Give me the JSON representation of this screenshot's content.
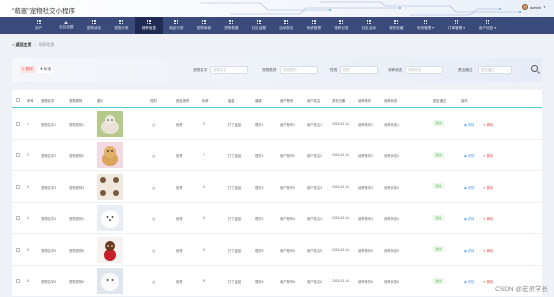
{
  "header": {
    "app_title": "\"萌崽\"宠物社交小程序",
    "username": "admin"
  },
  "nav": {
    "items": [
      {
        "label": "用户",
        "icon": "grid-icon"
      },
      {
        "label": "社区话题",
        "icon": "house-icon"
      },
      {
        "label": "宠物动态",
        "icon": "grid-icon"
      },
      {
        "label": "宠物分类",
        "icon": "grid-icon"
      },
      {
        "label": "领养信息",
        "icon": "grid-icon",
        "active": true
      },
      {
        "label": "商品分类",
        "icon": "grid-icon"
      },
      {
        "label": "宠物商城",
        "icon": "grid-icon"
      },
      {
        "label": "宠物救援",
        "icon": "grid-icon"
      },
      {
        "label": "社区话题",
        "icon": "grid-icon"
      },
      {
        "label": "活动报名",
        "icon": "grid-icon"
      },
      {
        "label": "系统管理",
        "icon": "grid-icon"
      },
      {
        "label": "领养记录",
        "icon": "grid-icon"
      },
      {
        "label": "社区活动",
        "icon": "grid-icon"
      },
      {
        "label": "我的收藏",
        "icon": "grid-icon"
      },
      {
        "label": "系统管理 ▾",
        "icon": "grid-icon"
      },
      {
        "label": "订单管理 ▾",
        "icon": "grid-icon"
      },
      {
        "label": "用户信息 ▾",
        "icon": "grid-icon"
      }
    ]
  },
  "breadcrumb": {
    "home": "返回主页",
    "sep": "/",
    "current": "领养信息"
  },
  "toolbar": {
    "delete_label": "✕ 删除",
    "add_label": "✚ 新增"
  },
  "search": {
    "fields": [
      {
        "label": "宠物名字",
        "placeholder": "宠物名字"
      },
      {
        "label": "宠物类别",
        "placeholder": "宠物类别"
      },
      {
        "label": "性别",
        "placeholder": "性别"
      },
      {
        "label": "领养状态",
        "placeholder": "领养状态"
      },
      {
        "label": "是否通过",
        "placeholder": "是否通过"
      }
    ]
  },
  "table": {
    "headers": [
      "序号",
      "宠物名字",
      "宠物类别",
      "图片",
      "性别",
      "是否绝育",
      "年龄",
      "疫苗",
      "健康",
      "用户账号",
      "用户姓名",
      "发布日期",
      "领养条件",
      "领养状态",
      "是否通过",
      "操作"
    ],
    "rows": [
      {
        "idx": "1",
        "name": "宠物名字1",
        "cat": "宠物类别1",
        "sex": "公",
        "neuter": "绝育",
        "age": "3",
        "vac": "打了疫苗",
        "health": "很好1",
        "acct": "用户账号1",
        "uname": "用户姓名1",
        "date": "2024-03-14",
        "cond": "领养条件1",
        "status": "领养状态1",
        "pass": "通过",
        "detail": "详情",
        "del": "删除"
      },
      {
        "idx": "2",
        "name": "宠物名字2",
        "cat": "宠物类别2",
        "sex": "公",
        "neuter": "绝育",
        "age": "7",
        "vac": "打了疫苗",
        "health": "很好2",
        "acct": "用户账号2",
        "uname": "用户姓名2",
        "date": "2024-03-14",
        "cond": "领养条件2",
        "status": "领养状态2",
        "pass": "通过",
        "detail": "详情",
        "del": "删除"
      },
      {
        "idx": "3",
        "name": "宠物名字3",
        "cat": "宠物类别3",
        "sex": "公",
        "neuter": "绝育",
        "age": "4",
        "vac": "打了疫苗",
        "health": "很好3",
        "acct": "用户账号3",
        "uname": "用户姓名3",
        "date": "2024-03-14",
        "cond": "领养条件3",
        "status": "领养状态3",
        "pass": "通过",
        "detail": "详情",
        "del": "删除"
      },
      {
        "idx": "4",
        "name": "宠物名字4",
        "cat": "宠物类别4",
        "sex": "公",
        "neuter": "绝育",
        "age": "6",
        "vac": "打了疫苗",
        "health": "很好4",
        "acct": "用户账号4",
        "uname": "用户姓名4",
        "date": "2024-03-14",
        "cond": "领养条件4",
        "status": "领养状态4",
        "pass": "通过",
        "detail": "详情",
        "del": "删除"
      },
      {
        "idx": "5",
        "name": "宠物名字5",
        "cat": "宠物类别5",
        "sex": "公",
        "neuter": "绝育",
        "age": "5",
        "vac": "打了疫苗",
        "health": "很好5",
        "acct": "用户账号5",
        "uname": "用户姓名5",
        "date": "2024-03-14",
        "cond": "领养条件5",
        "status": "领养状态5",
        "pass": "通过",
        "detail": "详情",
        "del": "删除"
      },
      {
        "idx": "6",
        "name": "宠物名字6",
        "cat": "宠物类别6",
        "sex": "公",
        "neuter": "绝育",
        "age": "8",
        "vac": "打了疫苗",
        "health": "很好6",
        "acct": "用户账号6",
        "uname": "用户姓名6",
        "date": "2024-03-14",
        "cond": "领养条件6",
        "status": "领养状态6",
        "pass": "通过",
        "detail": "详情",
        "del": "删除"
      }
    ]
  },
  "watermark": "CSDN @宏灵学长",
  "colors": {
    "nav_bg": "#3a4a7a",
    "nav_active": "#1f2b52",
    "accent_line": "#4fc9dc",
    "pass_green": "#5cb85c",
    "delete_red": "#e05a5a",
    "detail_blue": "#4a8fe0"
  }
}
